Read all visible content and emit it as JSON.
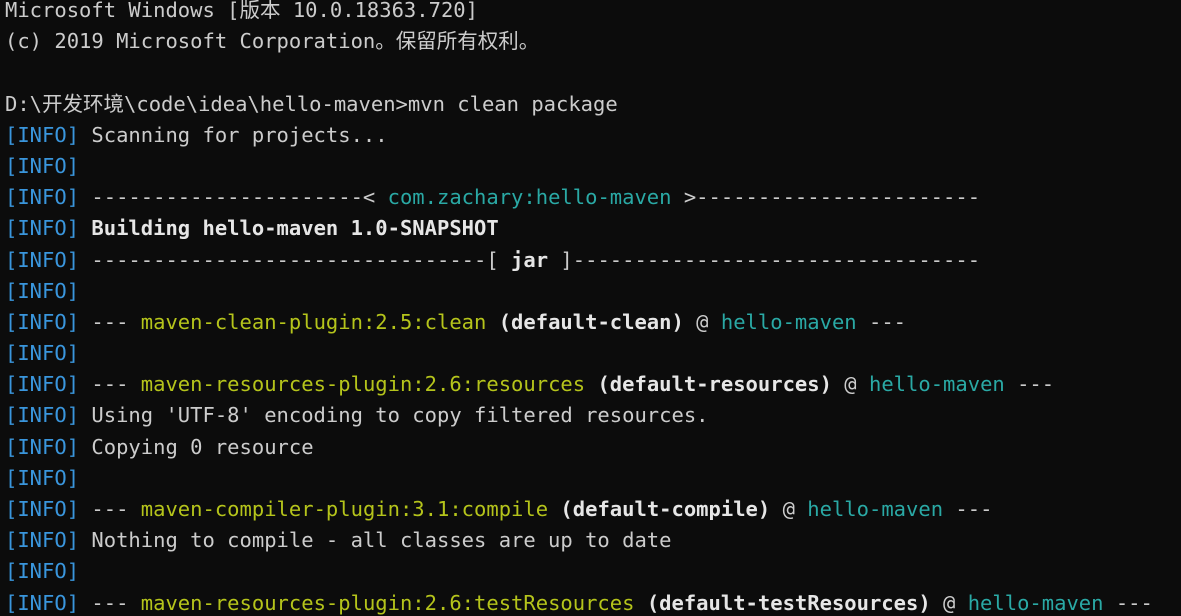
{
  "terminal": {
    "lines": [
      [
        {
          "text": "Microsoft Windows [版本 10.0.18363.720]",
          "style": "plain"
        }
      ],
      [
        {
          "text": "(c) 2019 Microsoft Corporation。保留所有权利。",
          "style": "plain"
        }
      ],
      [
        {
          "text": "",
          "style": "plain"
        }
      ],
      [
        {
          "text": "D:\\开发环境\\code\\idea\\hello-maven>mvn clean package",
          "style": "plain"
        }
      ],
      [
        {
          "text": "[INFO]",
          "style": "info"
        },
        {
          "text": " Scanning for projects...",
          "style": "plain"
        }
      ],
      [
        {
          "text": "[INFO]",
          "style": "info"
        }
      ],
      [
        {
          "text": "[INFO]",
          "style": "info"
        },
        {
          "text": " ----------------------< ",
          "style": "plain"
        },
        {
          "text": "com.zachary:hello-maven",
          "style": "project"
        },
        {
          "text": " >-----------------------",
          "style": "plain"
        }
      ],
      [
        {
          "text": "[INFO]",
          "style": "info"
        },
        {
          "text": " ",
          "style": "plain"
        },
        {
          "text": "Building hello-maven 1.0-SNAPSHOT",
          "style": "bold"
        }
      ],
      [
        {
          "text": "[INFO]",
          "style": "info"
        },
        {
          "text": " --------------------------------[ ",
          "style": "plain"
        },
        {
          "text": "jar",
          "style": "bold"
        },
        {
          "text": " ]---------------------------------",
          "style": "plain"
        }
      ],
      [
        {
          "text": "[INFO]",
          "style": "info"
        }
      ],
      [
        {
          "text": "[INFO]",
          "style": "info"
        },
        {
          "text": " --- ",
          "style": "plain"
        },
        {
          "text": "maven-clean-plugin:2.5:clean",
          "style": "plugin"
        },
        {
          "text": " ",
          "style": "plain"
        },
        {
          "text": "(default-clean)",
          "style": "bold"
        },
        {
          "text": " @ ",
          "style": "plain"
        },
        {
          "text": "hello-maven",
          "style": "project"
        },
        {
          "text": " ---",
          "style": "plain"
        }
      ],
      [
        {
          "text": "[INFO]",
          "style": "info"
        }
      ],
      [
        {
          "text": "[INFO]",
          "style": "info"
        },
        {
          "text": " --- ",
          "style": "plain"
        },
        {
          "text": "maven-resources-plugin:2.6:resources",
          "style": "plugin"
        },
        {
          "text": " ",
          "style": "plain"
        },
        {
          "text": "(default-resources)",
          "style": "bold"
        },
        {
          "text": " @ ",
          "style": "plain"
        },
        {
          "text": "hello-maven",
          "style": "project"
        },
        {
          "text": " ---",
          "style": "plain"
        }
      ],
      [
        {
          "text": "[INFO]",
          "style": "info"
        },
        {
          "text": " Using 'UTF-8' encoding to copy filtered resources.",
          "style": "plain"
        }
      ],
      [
        {
          "text": "[INFO]",
          "style": "info"
        },
        {
          "text": " Copying 0 resource",
          "style": "plain"
        }
      ],
      [
        {
          "text": "[INFO]",
          "style": "info"
        }
      ],
      [
        {
          "text": "[INFO]",
          "style": "info"
        },
        {
          "text": " --- ",
          "style": "plain"
        },
        {
          "text": "maven-compiler-plugin:3.1:compile",
          "style": "plugin"
        },
        {
          "text": " ",
          "style": "plain"
        },
        {
          "text": "(default-compile)",
          "style": "bold"
        },
        {
          "text": " @ ",
          "style": "plain"
        },
        {
          "text": "hello-maven",
          "style": "project"
        },
        {
          "text": " ---",
          "style": "plain"
        }
      ],
      [
        {
          "text": "[INFO]",
          "style": "info"
        },
        {
          "text": " Nothing to compile - all classes are up to date",
          "style": "plain"
        }
      ],
      [
        {
          "text": "[INFO]",
          "style": "info"
        }
      ],
      [
        {
          "text": "[INFO]",
          "style": "info"
        },
        {
          "text": " --- ",
          "style": "plain"
        },
        {
          "text": "maven-resources-plugin:2.6:testResources",
          "style": "plugin"
        },
        {
          "text": " ",
          "style": "plain"
        },
        {
          "text": "(default-testResources)",
          "style": "bold"
        },
        {
          "text": " @ ",
          "style": "plain"
        },
        {
          "text": "hello-maven",
          "style": "project"
        },
        {
          "text": " ---",
          "style": "plain"
        }
      ]
    ]
  },
  "colors": {
    "background": "#0c0c0c",
    "text": "#cccccc",
    "info_tag": "#3a96dd",
    "plugin": "#b5c41b",
    "project": "#2aa9a5",
    "bold_text": "#e6e6e6"
  }
}
